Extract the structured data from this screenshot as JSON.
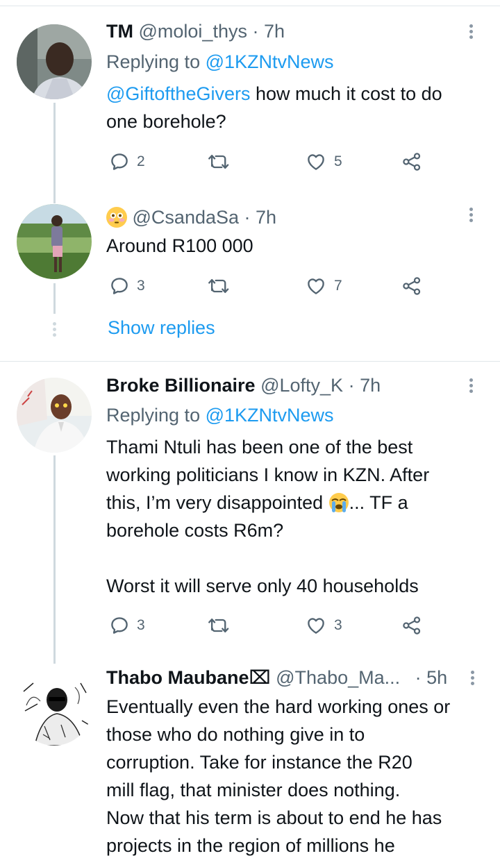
{
  "tweets": [
    {
      "name": "TM",
      "handle": "@moloi_thys",
      "time": "· 7h",
      "replying_label": "Replying to",
      "replying_to": "@1KZNtvNews",
      "mention": "@GiftoftheGivers",
      "text_line1": " how much it cost to do",
      "text_line2": "one borehole?",
      "replies": "2",
      "likes": "5"
    },
    {
      "name_emoji": "flushed-face",
      "handle": "@CsandaSa",
      "time": "· 7h",
      "text": "Around R100 000",
      "replies": "3",
      "likes": "7",
      "show_replies": "Show replies"
    },
    {
      "name": "Broke Billionaire",
      "handle": "@Lofty_K",
      "time": "· 7h",
      "replying_label": "Replying to",
      "replying_to": "@1KZNtvNews",
      "text_line1": "Thami Ntuli has been one of the best",
      "text_line2": "working politicians I know in KZN. After",
      "text_line3a": "this, I’m very disappointed ",
      "text_line3b": "... TF a",
      "text_line4": "borehole costs R6m?",
      "text_line5": "Worst it will serve only 40 households",
      "emoji": "loudly-crying-face",
      "replies": "3",
      "likes": "3"
    },
    {
      "name": "Thabo Maubane⌧",
      "handle": "@Thabo_Ma...",
      "time": "· 5h",
      "text_line1": "Eventually even the hard working ones or",
      "text_line2": "those who do nothing give in to",
      "text_line3": "corruption. Take for instance the R20",
      "text_line4": "mill flag, that minister does nothing.",
      "text_line5": "Now that his term is about to end he has",
      "text_line6": "projects in the region of millions he"
    }
  ],
  "icons": {
    "reply": "speech-bubble-icon",
    "retweet": "retweet-icon",
    "like": "heart-icon",
    "share": "share-icon",
    "more": "more-vertical-icon"
  },
  "colors": {
    "link": "#1d9bf0",
    "secondary_text": "#536471",
    "divider": "#e1e6ea"
  }
}
